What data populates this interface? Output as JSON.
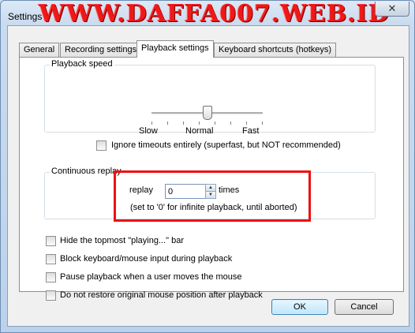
{
  "window": {
    "title": "Settings",
    "watermark": "WWW.DAFFA007.WEB.ID",
    "close_glyph": "✕"
  },
  "tabs": [
    {
      "label": "General",
      "active": false
    },
    {
      "label": "Recording settings",
      "active": false
    },
    {
      "label": "Playback settings",
      "active": true
    },
    {
      "label": "Keyboard shortcuts (hotkeys)",
      "active": false
    }
  ],
  "playback_speed": {
    "group_label": "Playback speed",
    "slider_labels": {
      "slow": "Slow",
      "normal": "Normal",
      "fast": "Fast"
    },
    "slider_position": 0.5,
    "ignore_timeouts_label": "Ignore timeouts entirely (superfast, but NOT recommended)",
    "ignore_timeouts_checked": false
  },
  "continuous_replay": {
    "group_label": "Continuous replay",
    "replay_label": "replay",
    "replay_value": "0",
    "times_label": "times",
    "hint": "(set to '0' for infinite playback, until aborted)",
    "highlight_color": "#ee1111"
  },
  "options": [
    {
      "label": "Hide the topmost \"playing...\" bar",
      "checked": false
    },
    {
      "label": "Block keyboard/mouse input during playback",
      "checked": false
    },
    {
      "label": "Pause playback when a user moves the mouse",
      "checked": false
    },
    {
      "label": "Do not restore original mouse position after playback",
      "checked": false
    }
  ],
  "buttons": {
    "ok": "OK",
    "cancel": "Cancel"
  }
}
